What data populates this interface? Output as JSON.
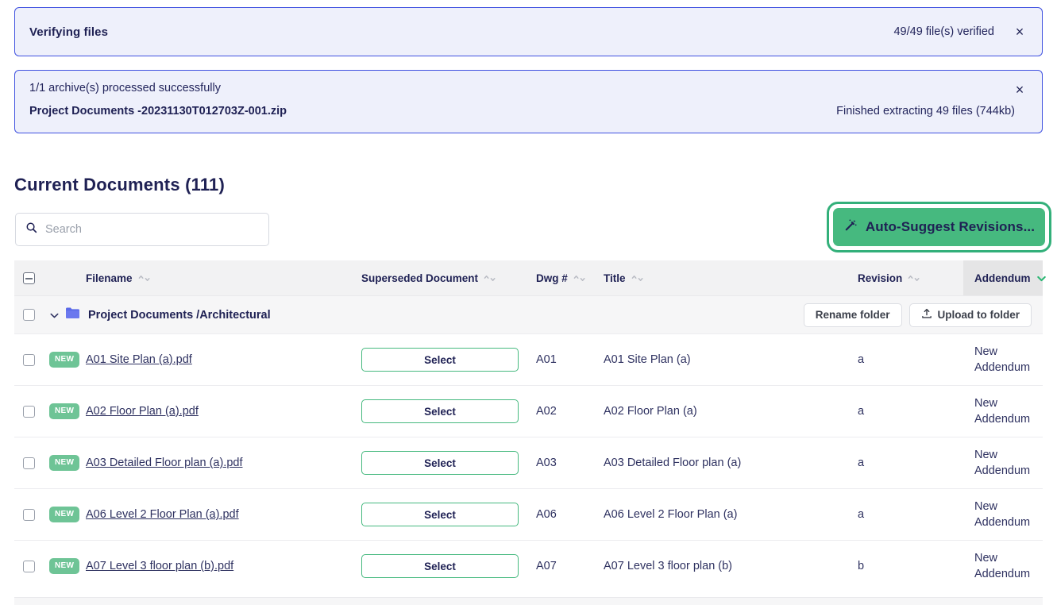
{
  "alerts": [
    {
      "id": "verifying-files",
      "title": "Verifying files",
      "status": "49/49 file(s) verified",
      "close_label": "×"
    },
    {
      "id": "archive-processed",
      "subtitle": "1/1 archive(s) processed successfully",
      "archive_name": "Project Documents -20231130T012703Z-001.zip",
      "meta": "Finished extracting 49 files (744kb)",
      "close_label": "×"
    }
  ],
  "page": {
    "title": "Current Documents (111)"
  },
  "search": {
    "placeholder": "Search",
    "value": "",
    "icon": "search-icon"
  },
  "autosuggest": {
    "label": "Auto-Suggest Revisions...",
    "icon": "magic-wand-icon",
    "fill_color": "#46b97f",
    "highlight_color": "#33b07a"
  },
  "table": {
    "columns": [
      {
        "key": "filename",
        "label": "Filename",
        "sort": "both"
      },
      {
        "key": "superseded",
        "label": "Superseded Document",
        "sort": "both"
      },
      {
        "key": "dwg",
        "label": "Dwg #",
        "sort": "both"
      },
      {
        "key": "title",
        "label": "Title",
        "sort": "both"
      },
      {
        "key": "revision",
        "label": "Revision",
        "sort": "both"
      },
      {
        "key": "addendum",
        "label": "Addendum",
        "sort": "desc-active"
      }
    ],
    "header_checkbox_state": "indeterminate",
    "folder": {
      "name": "Project Documents /Architectural",
      "expanded": true,
      "rename_label": "Rename folder",
      "upload_label": "Upload to folder",
      "upload_icon": "upload-icon",
      "folder_icon": "folder-icon"
    },
    "select_label": "Select",
    "new_badge_label": "NEW",
    "rows": [
      {
        "badge": "NEW",
        "filename": "A01 Site Plan (a).pdf",
        "superseded": "Select",
        "dwg": "A01",
        "title": "A01 Site Plan (a)",
        "revision": "a",
        "addendum": "New Addendum"
      },
      {
        "badge": "NEW",
        "filename": "A02 Floor Plan (a).pdf",
        "superseded": "Select",
        "dwg": "A02",
        "title": "A02 Floor Plan (a)",
        "revision": "a",
        "addendum": "New Addendum"
      },
      {
        "badge": "NEW",
        "filename": "A03 Detailed Floor plan (a).pdf",
        "superseded": "Select",
        "dwg": "A03",
        "title": "A03 Detailed Floor plan (a)",
        "revision": "a",
        "addendum": "New Addendum"
      },
      {
        "badge": "NEW",
        "filename": "A06 Level 2 Floor Plan (a).pdf",
        "superseded": "Select",
        "dwg": "A06",
        "title": "A06 Level 2 Floor Plan (a)",
        "revision": "a",
        "addendum": "New Addendum"
      },
      {
        "badge": "NEW",
        "filename": "A07 Level 3 floor plan (b).pdf",
        "superseded": "Select",
        "dwg": "A07",
        "title": "A07 Level 3 floor plan (b)",
        "revision": "b",
        "addendum": "New Addendum"
      }
    ]
  },
  "colors": {
    "accent_green": "#46b97f",
    "alert_bg": "#eef0fb",
    "alert_border": "#3f51e0",
    "text_navy": "#1f2154",
    "folder_icon": "#5b6ae8"
  }
}
